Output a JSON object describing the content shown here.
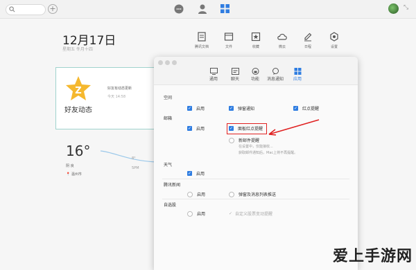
{
  "topbar": {
    "search_icon": "search-icon",
    "add_label": "+",
    "icons": [
      "chat-icon",
      "contacts-icon",
      "apps-icon"
    ],
    "shrink_icon": "collapse-icon"
  },
  "home": {
    "date": "12月17日",
    "subdate": "星期五  冬月十四",
    "apps": [
      {
        "label": "腾讯文档",
        "icon": "doc-icon"
      },
      {
        "label": "文件",
        "icon": "file-icon"
      },
      {
        "label": "收藏",
        "icon": "star-icon"
      },
      {
        "label": "微云",
        "icon": "cloud-icon"
      },
      {
        "label": "日程",
        "icon": "edit-icon"
      },
      {
        "label": "设置",
        "icon": "settings-icon"
      }
    ],
    "friend_card": {
      "title": "好友动态",
      "line1": "好友有动态更新",
      "line2": "今天 14:58"
    },
    "weather": {
      "temp": "16°",
      "cond": "阴  良",
      "city": "温州市",
      "curve_top": "8°",
      "curve_bottom": "5PM"
    }
  },
  "prefs": {
    "tabs": [
      {
        "label": "通用",
        "icon": "monitor-icon"
      },
      {
        "label": "聊天",
        "icon": "chat-window-icon"
      },
      {
        "label": "功能",
        "icon": "lock-icon"
      },
      {
        "label": "消息通知",
        "icon": "bubble-icon"
      },
      {
        "label": "应用",
        "icon": "grid-icon"
      }
    ],
    "active_tab": "应用",
    "sections": {
      "space": "空间",
      "mail": "邮箱",
      "weather": "天气",
      "news": "腾讯新闻",
      "stock": "自选股"
    },
    "opts": {
      "enable": "启用",
      "popup_notify": "弹窗通知",
      "red_dot": "红点提醒",
      "panel_red_dot": "面板红点提醒",
      "new_mail": "新邮件提醒",
      "mail_hint1": "在设置中，仅能接收...",
      "mail_hint2": "获取邮件通知后，Mac上将不再提醒。",
      "popup_list": "弹窗及消息列表推送",
      "stock_hint": "自定义股票变动提醒"
    },
    "accent": "#2f7de1"
  },
  "watermark": "爱上手游网"
}
